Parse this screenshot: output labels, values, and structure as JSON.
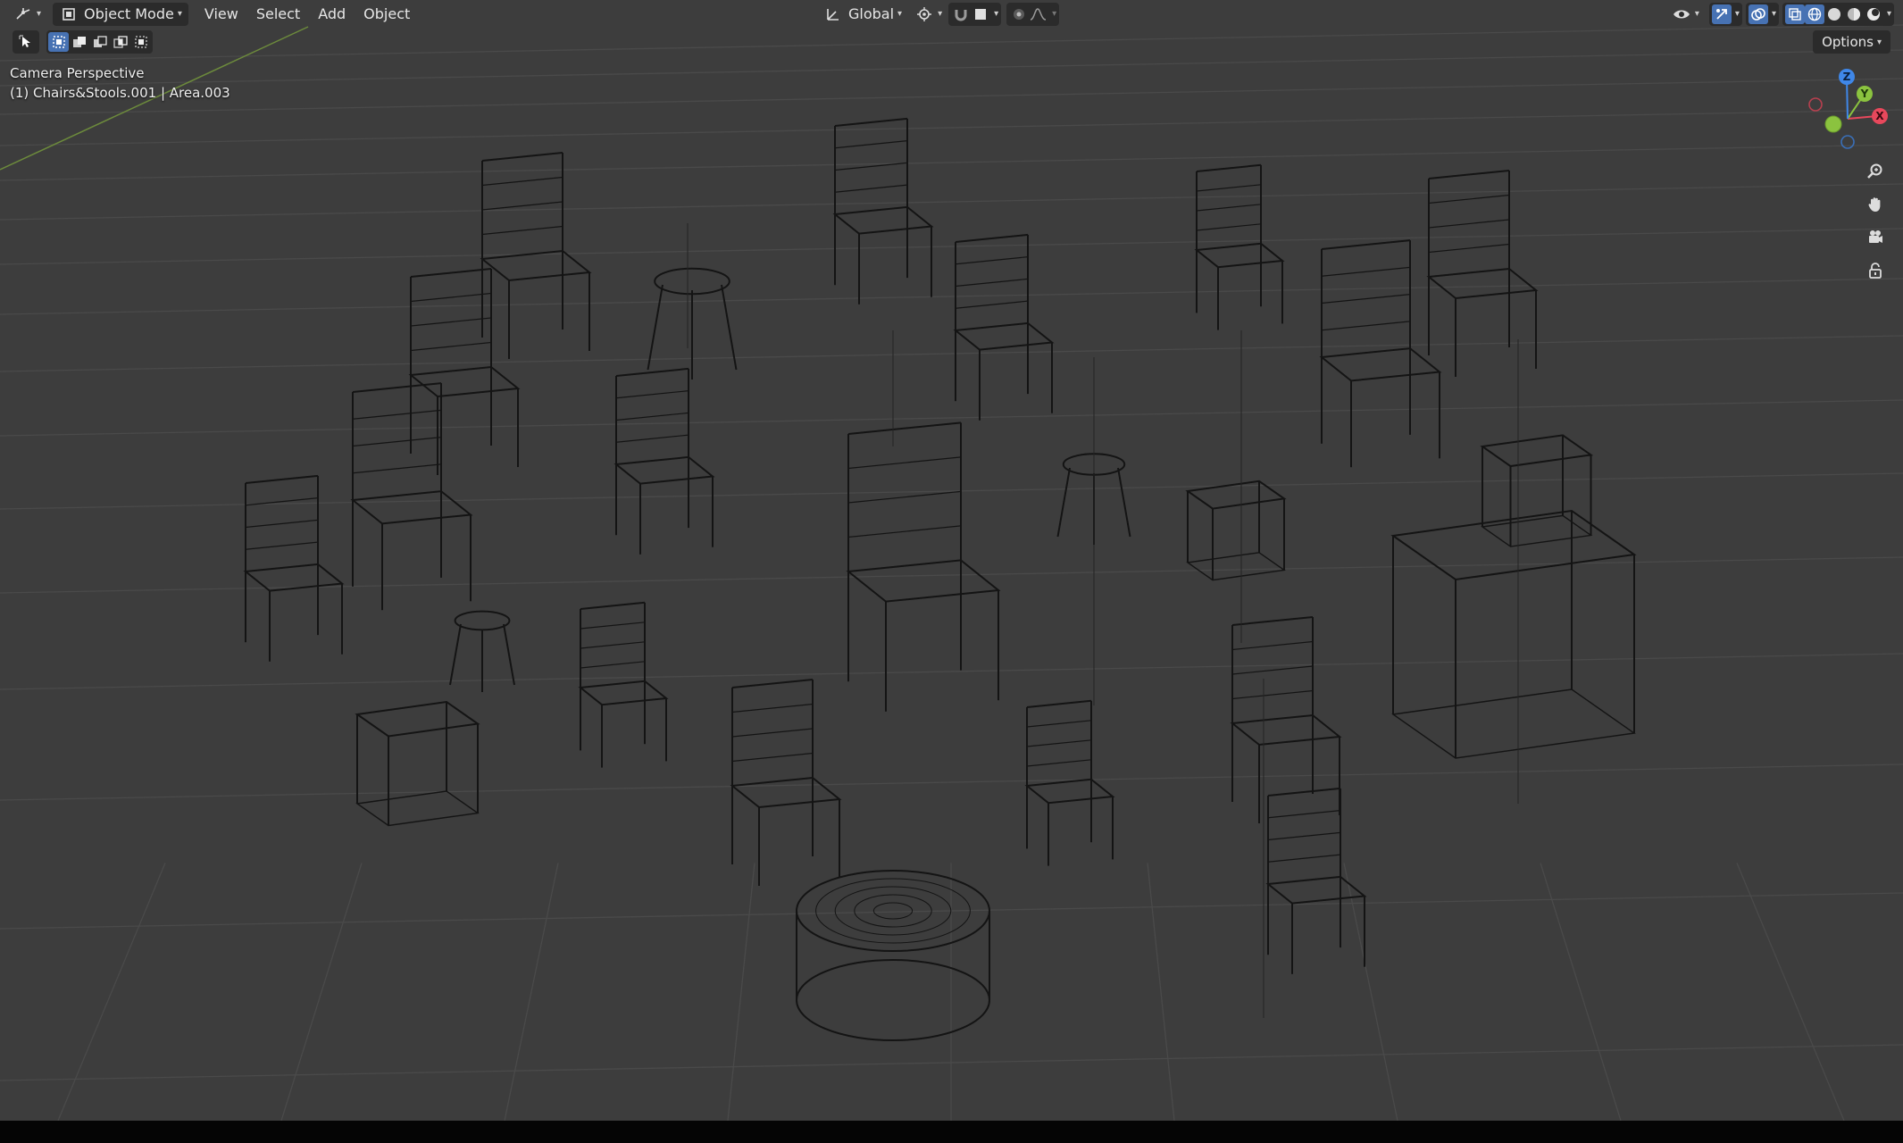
{
  "header": {
    "editor_type_icon": "3d-viewport-icon",
    "mode": {
      "label": "Object Mode",
      "icon": "object-mode-icon"
    },
    "menus": [
      "View",
      "Select",
      "Add",
      "Object"
    ],
    "transform_orientation": {
      "label": "Global",
      "icon": "transform-orientation-icon"
    },
    "pivot_icon": "pivot-point-icon",
    "snap_icon": "snap-magnet-icon",
    "snap_target_icon": "snap-target-icon",
    "proportional_icon": "proportional-editing-icon",
    "falloff_icon": "falloff-curve-icon",
    "right_icons": [
      "visibility-eye-icon",
      "gizmo-icon",
      "overlays-icon",
      "xray-icon",
      "wireframe-shading-icon",
      "solid-shading-icon",
      "material-shading-icon",
      "rendered-shading-icon"
    ],
    "active_shading": "wireframe"
  },
  "toolbar": {
    "active_tool_icon": "select-cursor-icon",
    "selection_modes": [
      "select-new-icon",
      "select-extend-icon",
      "select-subtract-icon",
      "select-invert-icon",
      "select-intersect-icon"
    ],
    "options_label": "Options"
  },
  "viewport": {
    "view_name": "Camera Perspective",
    "collection_info": "(1) Chairs&Stools.001 | Area.003",
    "background": "#3d3d3d",
    "grid_color": "#4a4a4a",
    "wire_color": "#141414"
  },
  "gizmo": {
    "x_label": "X",
    "y_label": "Y",
    "z_label": "Z",
    "colors": {
      "x": "#e8485c",
      "y": "#8bc33f",
      "z": "#3f87e8"
    }
  },
  "nav_buttons": [
    "zoom-icon",
    "pan-hand-icon",
    "camera-view-icon",
    "lock-icon"
  ]
}
